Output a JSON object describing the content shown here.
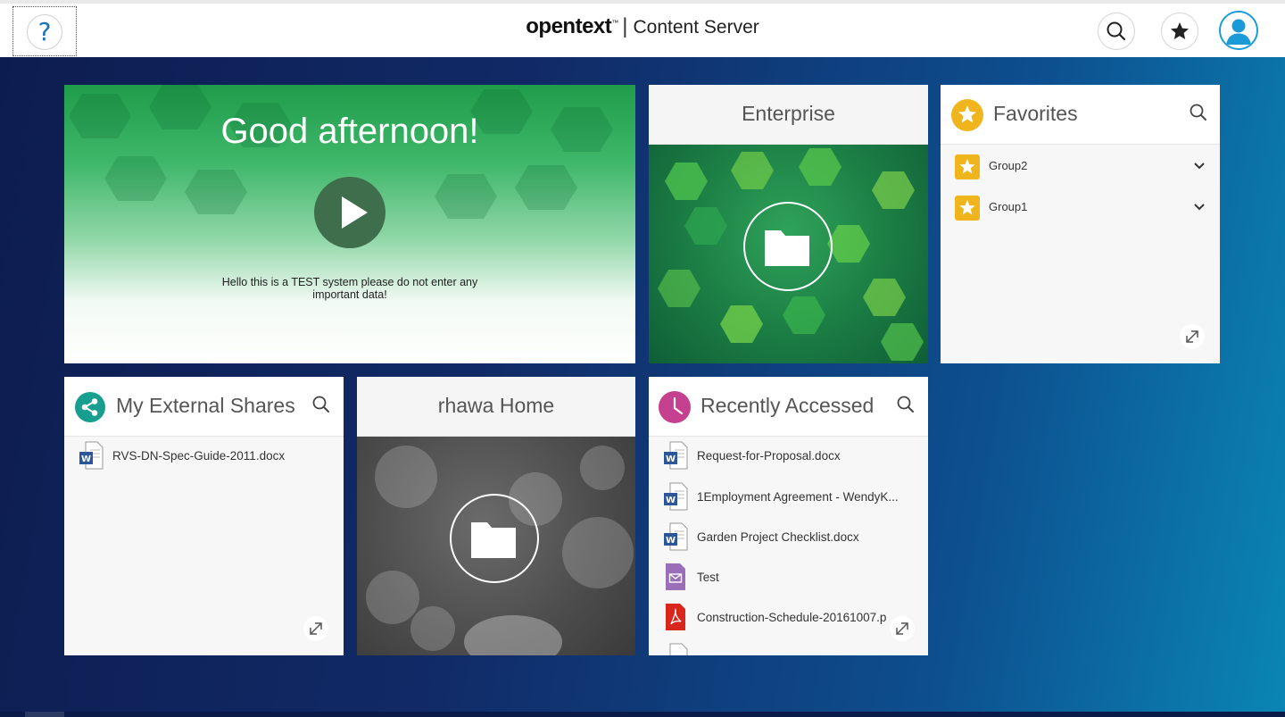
{
  "header": {
    "help_icon_text": "?",
    "brand_logo": "opentext",
    "brand_tm": "™",
    "brand_separator": "|",
    "product_name": "Content Server"
  },
  "greeting": {
    "title": "Good afternoon!",
    "message": "Hello this is a TEST system please do not enter any important data!"
  },
  "enterprise": {
    "title": "Enterprise"
  },
  "favorites": {
    "title": "Favorites",
    "groups": [
      {
        "label": "Group2"
      },
      {
        "label": "Group1"
      }
    ]
  },
  "external_shares": {
    "title": "My External Shares",
    "items": [
      {
        "label": "RVS-DN-Spec-Guide-2011.docx",
        "icon": "word-doc-icon"
      }
    ]
  },
  "home": {
    "title": "rhawa Home"
  },
  "recent": {
    "title": "Recently Accessed",
    "items": [
      {
        "label": "Request-for-Proposal.docx",
        "icon": "word-doc-icon"
      },
      {
        "label": "1Employment Agreement - WendyK...",
        "icon": "word-doc-icon"
      },
      {
        "label": "Garden Project Checklist.docx",
        "icon": "word-doc-icon"
      },
      {
        "label": "Test",
        "icon": "email-icon"
      },
      {
        "label": "Construction-Schedule-20161007.p",
        "icon": "pdf-icon"
      }
    ]
  },
  "colors": {
    "accent_blue": "#1a73b8",
    "favorites_star": "#f0b41c",
    "shares_teal": "#169e8f",
    "recent_magenta": "#c5408f"
  }
}
